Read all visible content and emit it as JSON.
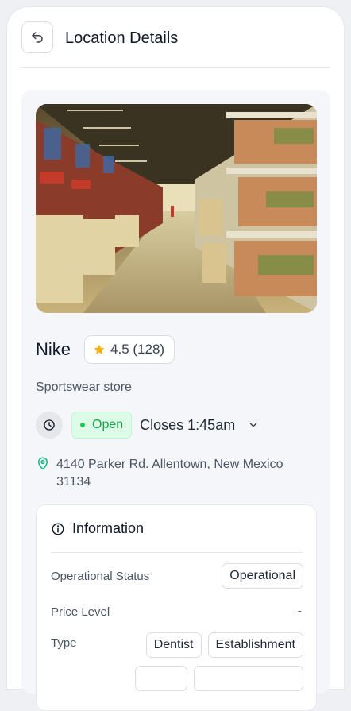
{
  "header": {
    "title": "Location Details",
    "back_icon": "undo-arrow-icon"
  },
  "store": {
    "name": "Nike",
    "rating": "4.5 (128)",
    "category": "Sportswear store",
    "status": "Open",
    "closing": "Closes 1:45am",
    "address": "4140 Parker Rd. Allentown, New Mexico 31134"
  },
  "information": {
    "title": "Information",
    "operational_status_label": "Operational Status",
    "operational_status_value": "Operational",
    "price_level_label": "Price Level",
    "price_level_value": "-",
    "type_label": "Type",
    "types": [
      "Dentist",
      "Establishment"
    ]
  },
  "colors": {
    "accent_green": "#16a34a",
    "star": "#f5b00b",
    "pin": "#10b981"
  }
}
